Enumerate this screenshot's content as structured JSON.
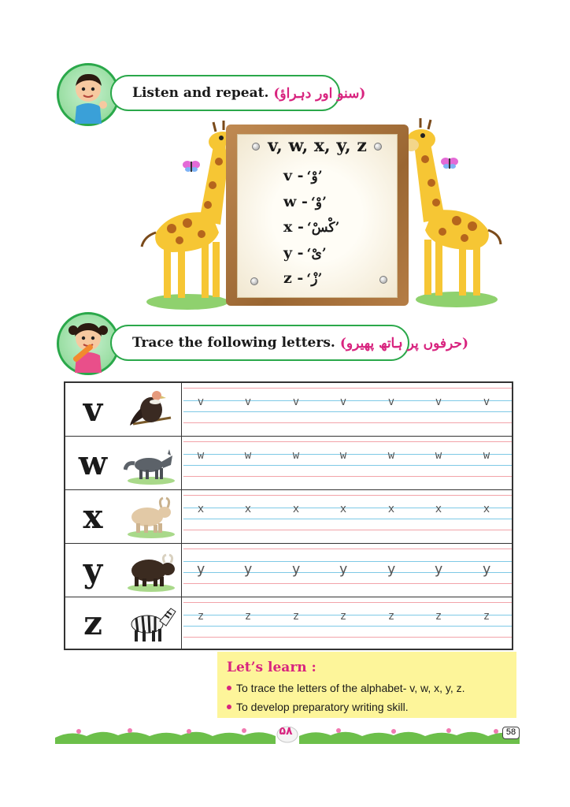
{
  "section1": {
    "title": "Listen and repeat.",
    "urdu": "(سنو اور دہراؤ)"
  },
  "board": {
    "title": "v, w, x, y, z",
    "pairs": [
      {
        "letter": "v -",
        "urdu": "‘وْ’"
      },
      {
        "letter": "w -",
        "urdu": "‘وْ’"
      },
      {
        "letter": "x -",
        "urdu": "‘کْسْ’"
      },
      {
        "letter": "y -",
        "urdu": "‘یْ’"
      },
      {
        "letter": "z -",
        "urdu": "‘زْ’"
      }
    ]
  },
  "section2": {
    "title": "Trace the following letters.",
    "urdu": "(حرفوں پر ہاتھ پھیرو)"
  },
  "rows": [
    {
      "letter": "v",
      "animal": "vulture-icon",
      "trace": "v"
    },
    {
      "letter": "w",
      "animal": "wolf-icon",
      "trace": "w"
    },
    {
      "letter": "x",
      "animal": "ox-icon",
      "trace": "x"
    },
    {
      "letter": "y",
      "animal": "yak-icon",
      "trace": "y"
    },
    {
      "letter": "z",
      "animal": "zebra-icon",
      "trace": "z"
    }
  ],
  "learn": {
    "title": "Let’s learn :",
    "items": [
      "To trace the letters of the alphabet- v, w, x, y, z.",
      "To develop preparatory writing skill."
    ]
  },
  "footer": {
    "urdu_page": "۵۸",
    "page": "58"
  },
  "colors": {
    "accent_green": "#2aa84a",
    "urdu_pink": "#d8247f",
    "learn_bg": "#fdf59a"
  }
}
